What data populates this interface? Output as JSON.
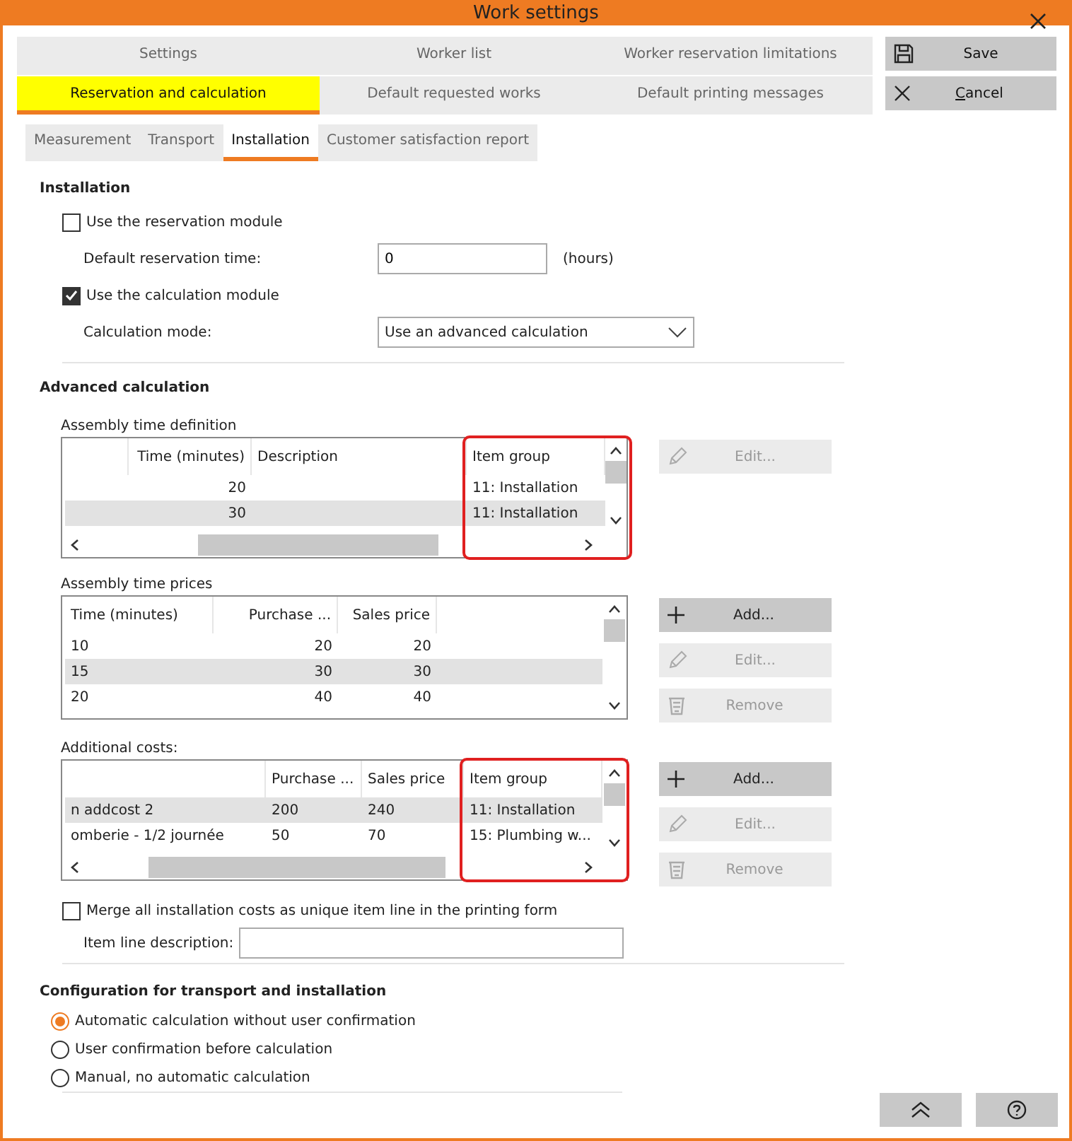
{
  "window": {
    "title": "Work settings"
  },
  "tabs": [
    [
      {
        "label": "Settings",
        "selected": false
      },
      {
        "label": "Worker list",
        "selected": false
      },
      {
        "label": "Worker reservation limitations",
        "selected": false
      }
    ],
    [
      {
        "label": "Reservation and calculation",
        "selected": true
      },
      {
        "label": "Default requested works",
        "selected": false
      },
      {
        "label": "Default printing messages",
        "selected": false
      }
    ]
  ],
  "subtabs": [
    {
      "label": "Measurement",
      "selected": false
    },
    {
      "label": "Transport",
      "selected": false
    },
    {
      "label": "Installation",
      "selected": true
    },
    {
      "label": "Customer satisfaction report",
      "selected": false
    }
  ],
  "actions": [
    {
      "kind": "save",
      "label": "Save"
    },
    {
      "kind": "cancel",
      "label": "Cancel"
    }
  ],
  "installation": {
    "title": "Installation",
    "use_reservation": {
      "label": "Use the reservation module",
      "checked": false
    },
    "reservation_time": {
      "label": "Default reservation time:",
      "value": "0",
      "unit": "(hours)"
    },
    "use_calculation": {
      "label": "Use the calculation module",
      "checked": true
    },
    "calculation_mode": {
      "label": "Calculation mode:",
      "value": "Use an advanced calculation"
    }
  },
  "advanced": {
    "title": "Advanced calculation",
    "tables": [
      {
        "title": "Assembly time definition",
        "hscroll": true,
        "columns": [
          {},
          {
            "label": "Time (minutes)"
          },
          {
            "label": "Description"
          },
          {
            "label": "Item group",
            "highlighted": true
          }
        ],
        "rows": [
          {
            "selected": false,
            "cells": [
              "",
              "20",
              "",
              "11: Installation"
            ]
          },
          {
            "selected": true,
            "cells": [
              "",
              "30",
              "",
              "11: Installation"
            ]
          }
        ],
        "buttons": [
          {
            "kind": "edit",
            "label": "Edit...",
            "disabled": true
          }
        ]
      },
      {
        "title": "Assembly time prices",
        "columns": [
          {
            "label": "Time (minutes)"
          },
          {
            "label": "Purchase ..."
          },
          {
            "label": "Sales price"
          }
        ],
        "rows": [
          {
            "selected": false,
            "cells": [
              "10",
              "20",
              "20"
            ]
          },
          {
            "selected": true,
            "cells": [
              "15",
              "30",
              "30"
            ]
          },
          {
            "selected": false,
            "cells": [
              "20",
              "40",
              "40"
            ]
          }
        ],
        "buttons": [
          {
            "kind": "add",
            "label": "Add...",
            "disabled": false
          },
          {
            "kind": "edit",
            "label": "Edit...",
            "disabled": true
          },
          {
            "kind": "remove",
            "label": "Remove",
            "disabled": true
          }
        ]
      },
      {
        "title": "Additional costs:",
        "hscroll": true,
        "columns": [
          {},
          {
            "label": "Purchase ..."
          },
          {
            "label": "Sales price"
          },
          {
            "label": "Item group",
            "highlighted": true
          }
        ],
        "rows": [
          {
            "selected": true,
            "cells": [
              "n addcost 2",
              "200",
              "240",
              "11: Installation"
            ]
          },
          {
            "selected": false,
            "cells": [
              "omberie - 1/2 journée",
              "50",
              "70",
              "15: Plumbing w..."
            ]
          }
        ],
        "buttons": [
          {
            "kind": "add",
            "label": "Add...",
            "disabled": false
          },
          {
            "kind": "edit",
            "label": "Edit...",
            "disabled": true
          },
          {
            "kind": "remove",
            "label": "Remove",
            "disabled": true
          }
        ]
      }
    ],
    "merge": {
      "label": "Merge all installation costs as unique item line in the printing form",
      "checked": false
    },
    "item_line": {
      "label": "Item line description:"
    }
  },
  "configuration": {
    "title": "Configuration for transport and installation",
    "options": [
      {
        "label": "Automatic calculation without user confirmation",
        "selected": true
      },
      {
        "label": "User confirmation before calculation",
        "selected": false
      },
      {
        "label": "Manual, no automatic calculation",
        "selected": false
      }
    ]
  },
  "footer_buttons": [
    {
      "kind": "collapse"
    },
    {
      "kind": "help"
    }
  ]
}
